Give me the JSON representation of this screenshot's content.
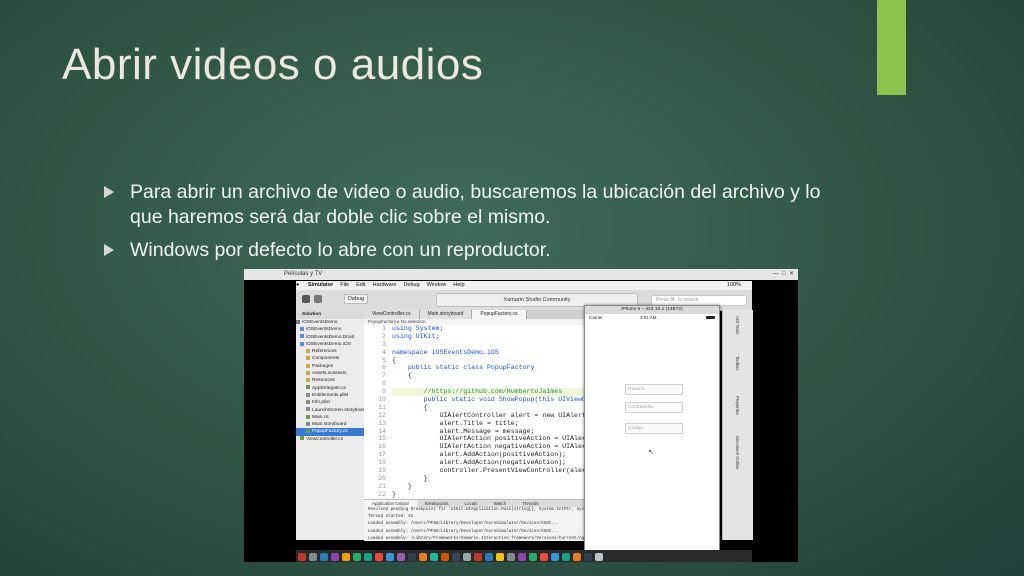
{
  "slide": {
    "title": "Abrir videos o audios",
    "bullets": [
      "Para abrir un archivo de video o audio, buscaremos la ubicación del archivo y lo que haremos será dar doble clic sobre el mismo.",
      "Windows por defecto lo abre con un reproductor."
    ],
    "accent_color": "#8ac44a"
  },
  "screenshot": {
    "window_title": "Películas y TV",
    "menubar": [
      "Simulator",
      "File",
      "Edit",
      "Hardware",
      "Debug",
      "Window",
      "Help"
    ],
    "menubar_right": "100%",
    "toolbar": {
      "scheme": "Debug",
      "status": "Xamarin Studio Community",
      "search_placeholder": "Press ⌘. to search"
    },
    "editor_tabs": [
      "ViewController.cs",
      "Main.storyboard",
      "PopupFactory.cs"
    ],
    "breadcrumb": "PopupFactory ▸ No selection",
    "solution_header": "Solution",
    "solution_items": [
      {
        "label": "iOSEventsDemo",
        "color": "#7a7a7a"
      },
      {
        "label": "iOSEventsDemo",
        "color": "#5c8fd6"
      },
      {
        "label": "iOSEventsDemo.Droid",
        "color": "#5c8fd6"
      },
      {
        "label": "iOSEventsDemo.iOS",
        "color": "#5c8fd6"
      },
      {
        "label": "References",
        "color": "#c9a84a"
      },
      {
        "label": "Components",
        "color": "#c9a84a"
      },
      {
        "label": "Packages",
        "color": "#c9a84a"
      },
      {
        "label": "Assets.xcassets",
        "color": "#c9a84a"
      },
      {
        "label": "Resources",
        "color": "#c9a84a"
      },
      {
        "label": "AppDelegate.cs",
        "color": "#6a9a4a"
      },
      {
        "label": "Entitlements.plist",
        "color": "#8a8a8a"
      },
      {
        "label": "Info.plist",
        "color": "#8a8a8a"
      },
      {
        "label": "LaunchScreen.storyboard",
        "color": "#8a8a8a"
      },
      {
        "label": "Main.cs",
        "color": "#6a9a4a"
      },
      {
        "label": "Main.storyboard",
        "color": "#8a8a8a"
      },
      {
        "label": "PopupFactory.cs",
        "color": "#6a9a4a"
      },
      {
        "label": "ViewController.cs",
        "color": "#6a9a4a"
      }
    ],
    "selected_item_index": 15,
    "code_lines": [
      {
        "n": "1",
        "text": "using System;"
      },
      {
        "n": "2",
        "text": "using UIKit;"
      },
      {
        "n": "3",
        "text": ""
      },
      {
        "n": "4",
        "text": "namespace iOSEventsDemo.iOS"
      },
      {
        "n": "5",
        "text": "{"
      },
      {
        "n": "6",
        "text": "    public static class PopupFactory"
      },
      {
        "n": "7",
        "text": "    {"
      },
      {
        "n": "8",
        "text": ""
      },
      {
        "n": "9",
        "text": "        //https://github.com/HumbertoJaimes"
      },
      {
        "n": "10",
        "text": "        public static void ShowPopup(this UIViewCo"
      },
      {
        "n": "11",
        "text": "        {"
      },
      {
        "n": "12",
        "text": "            UIAlertController alert = new UIAlertCo"
      },
      {
        "n": "13",
        "text": "            alert.Title = title;"
      },
      {
        "n": "14",
        "text": "            alert.Message = message;"
      },
      {
        "n": "15",
        "text": "            UIAlertAction positiveAction = UIAlertA"
      },
      {
        "n": "16",
        "text": "            UIAlertAction negativeAction = UIAlertA"
      },
      {
        "n": "17",
        "text": "            alert.AddAction(positiveAction);"
      },
      {
        "n": "18",
        "text": "            alert.AddAction(negativeAction);"
      },
      {
        "n": "19",
        "text": "            controller.PresentViewController(alert,"
      },
      {
        "n": "20",
        "text": "        }"
      },
      {
        "n": "21",
        "text": "    }"
      },
      {
        "n": "22",
        "text": "}"
      }
    ],
    "output_tabs": [
      "Application Output",
      "Breakpoints",
      "Locals",
      "Watch",
      "Threads"
    ],
    "output_lines": [
      "Resolved pending breakpoint for 'UIKit.UIApplication.Main(string[], System.IntPtr, System.",
      "Thread started: #2",
      "Loaded assembly: /Users/PF86/Library/Developer/CoreSimulator/Devices/C5DC...",
      "Loaded assembly: /Users/PF86/Library/Developer/CoreSimulator/Devices/C5DC...",
      "Loaded assembly: /Library/Frameworks/Xamarin.Interactive.framework/Versions/Current/Agents"
    ],
    "right_panel_tabs": [
      "Unit Tests",
      "Toolbox",
      "Properties",
      "Document Outline"
    ],
    "simulator": {
      "title": "iPhone 6 – iOS 10.1 (14B72)",
      "carrier": "Carrier",
      "time": "3:01 AM",
      "fields": [
        "Usuario",
        "Contraseña",
        "Código"
      ]
    },
    "dock_colors": [
      "#c0392b",
      "#7f8c8d",
      "#2980b9",
      "#8e44ad",
      "#f39c12",
      "#27ae60",
      "#16a085",
      "#e74c3c",
      "#3498db",
      "#9b59b6",
      "#2c3e50",
      "#e67e22",
      "#1abc9c",
      "#d35400",
      "#34495e",
      "#95a5a6",
      "#c0392b",
      "#2980b9",
      "#f1c40f",
      "#7f8c8d",
      "#8e44ad",
      "#27ae60",
      "#e74c3c",
      "#3498db",
      "#16a085",
      "#e67e22",
      "#2c3e50",
      "#bdc3c7"
    ],
    "output_right": "Tests"
  }
}
